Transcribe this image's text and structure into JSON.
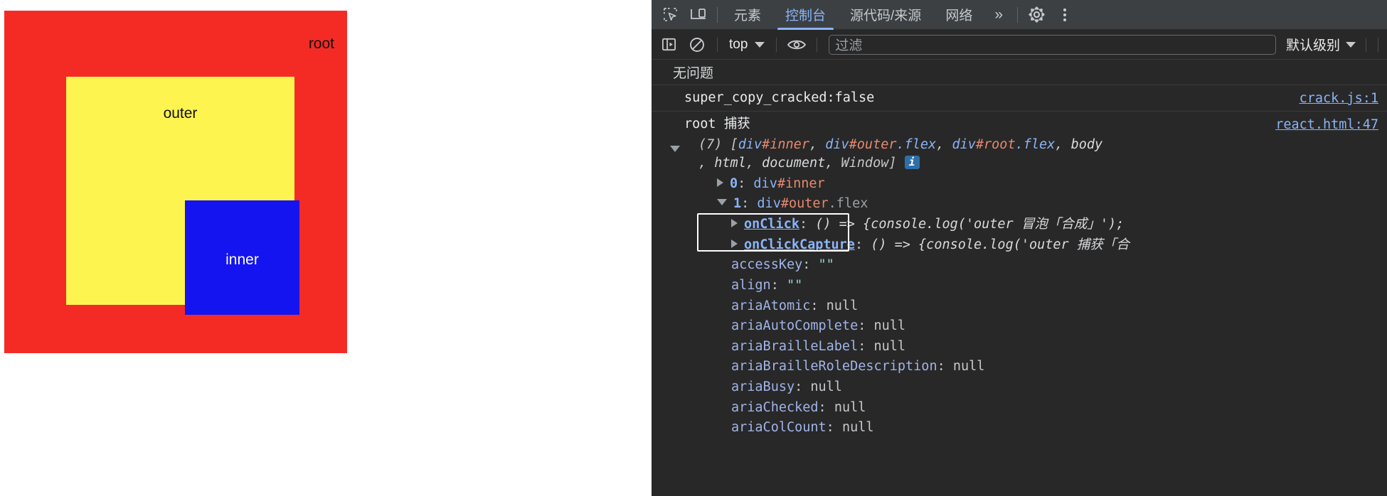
{
  "page": {
    "boxes": {
      "root_label": "root",
      "outer_label": "outer",
      "inner_label": "inner",
      "root_color": "#f42b25",
      "outer_color": "#fdf450",
      "inner_color": "#1414f0"
    }
  },
  "devtools": {
    "toolbar_icons": {
      "inspect": "inspect-element-icon",
      "device": "device-toolbar-icon",
      "settings": "gear-icon",
      "more": "kebab-menu-icon"
    },
    "tabs": [
      {
        "label": "元素",
        "active": false
      },
      {
        "label": "控制台",
        "active": true
      },
      {
        "label": "源代码/来源",
        "active": false
      },
      {
        "label": "网络",
        "active": false
      }
    ],
    "tab_overflow": "»",
    "console_toolbar": {
      "sidebar_icon": "console-sidebar-icon",
      "clear_icon": "clear-console-icon",
      "context_value": "top",
      "eye_icon": "live-expression-icon",
      "filter_placeholder": "过滤",
      "filter_value": "",
      "levels_value": "默认级别"
    },
    "issues_text": "无问题",
    "log": {
      "row1": {
        "message": "super_copy_cracked:false",
        "source": "crack.js:1"
      },
      "row2": {
        "message": "root 捕获",
        "source": "react.html:47",
        "array_count": "(7)",
        "array_open": "[",
        "array_items": [
          "div#inner",
          "div#outer.flex",
          "div#root.flex",
          "body",
          "html",
          "document",
          "Window"
        ],
        "array_close": "]",
        "info_badge": "i",
        "entries": [
          {
            "index": "0",
            "tag": "div",
            "id": "#inner",
            "cls": "",
            "expanded": false
          },
          {
            "index": "1",
            "tag": "div",
            "id": "#outer",
            "cls": ".flex",
            "expanded": true
          }
        ],
        "props": [
          {
            "name": "onClick",
            "sep": ": ",
            "value": "() => {console.log('outer 冒泡「合成」');",
            "kind": "fn",
            "highlight": true
          },
          {
            "name": "onClickCapture",
            "sep": ": ",
            "value": "() => {console.log('outer 捕获「合",
            "kind": "fn",
            "highlight": true
          },
          {
            "name": "accessKey",
            "sep": ": ",
            "value": "\"\"",
            "kind": "str",
            "highlight": false
          },
          {
            "name": "align",
            "sep": ": ",
            "value": "\"\"",
            "kind": "str",
            "highlight": false
          },
          {
            "name": "ariaAtomic",
            "sep": ": ",
            "value": "null",
            "kind": "null",
            "highlight": false
          },
          {
            "name": "ariaAutoComplete",
            "sep": ": ",
            "value": "null",
            "kind": "null",
            "highlight": false
          },
          {
            "name": "ariaBrailleLabel",
            "sep": ": ",
            "value": "null",
            "kind": "null",
            "highlight": false
          },
          {
            "name": "ariaBrailleRoleDescription",
            "sep": ": ",
            "value": "null",
            "kind": "null",
            "highlight": false
          },
          {
            "name": "ariaBusy",
            "sep": ": ",
            "value": "null",
            "kind": "null",
            "highlight": false
          },
          {
            "name": "ariaChecked",
            "sep": ": ",
            "value": "null",
            "kind": "null",
            "highlight": false
          },
          {
            "name": "ariaColCount",
            "sep": ": ",
            "value": "null",
            "kind": "null",
            "highlight": false
          }
        ]
      }
    }
  }
}
